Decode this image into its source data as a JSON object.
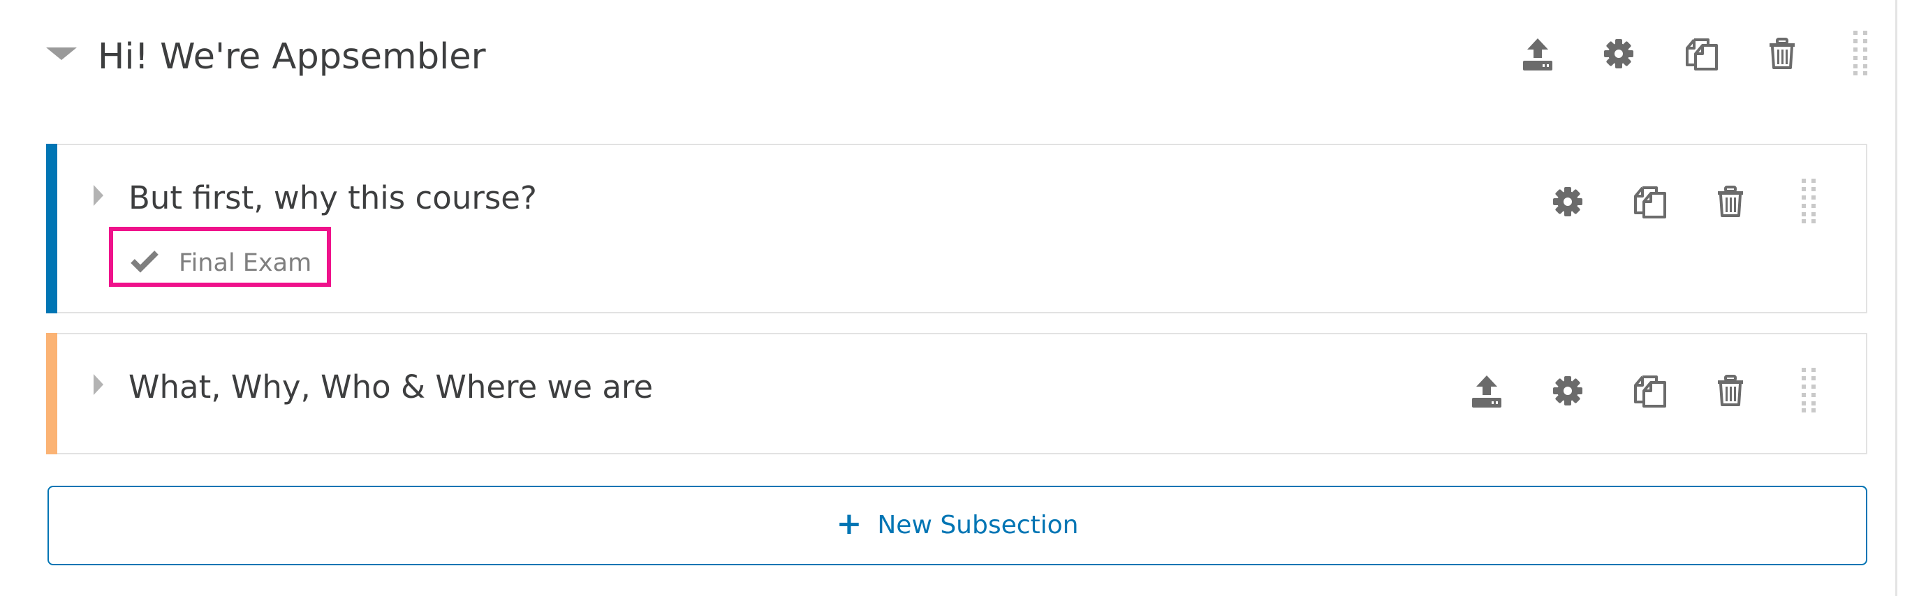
{
  "section": {
    "title": "Hi! We're Appsembler",
    "actions": [
      "publish-icon",
      "gear-icon",
      "duplicate-icon",
      "trash-icon",
      "drag-handle-icon"
    ]
  },
  "subsections": [
    {
      "title": "But first, why this course?",
      "accent_color": "#0075b4",
      "actions": [
        "gear-icon",
        "duplicate-icon",
        "trash-icon",
        "drag-handle-icon"
      ],
      "units": [
        {
          "label": "Final Exam",
          "status_icon": "checkmark-icon",
          "highlighted": true,
          "highlight_color": "#ef128b"
        }
      ]
    },
    {
      "title": "What, Why, Who & Where we are",
      "accent_color": "#fbb374",
      "actions": [
        "publish-icon",
        "gear-icon",
        "duplicate-icon",
        "trash-icon",
        "drag-handle-icon"
      ],
      "units": []
    }
  ],
  "new_subsection": {
    "label": "New Subsection",
    "icon": "plus-icon"
  },
  "colors": {
    "primary": "#0075b4",
    "text": "#3d3e3f",
    "icon": "#6b6b6b",
    "border": "#e2e2e2"
  }
}
